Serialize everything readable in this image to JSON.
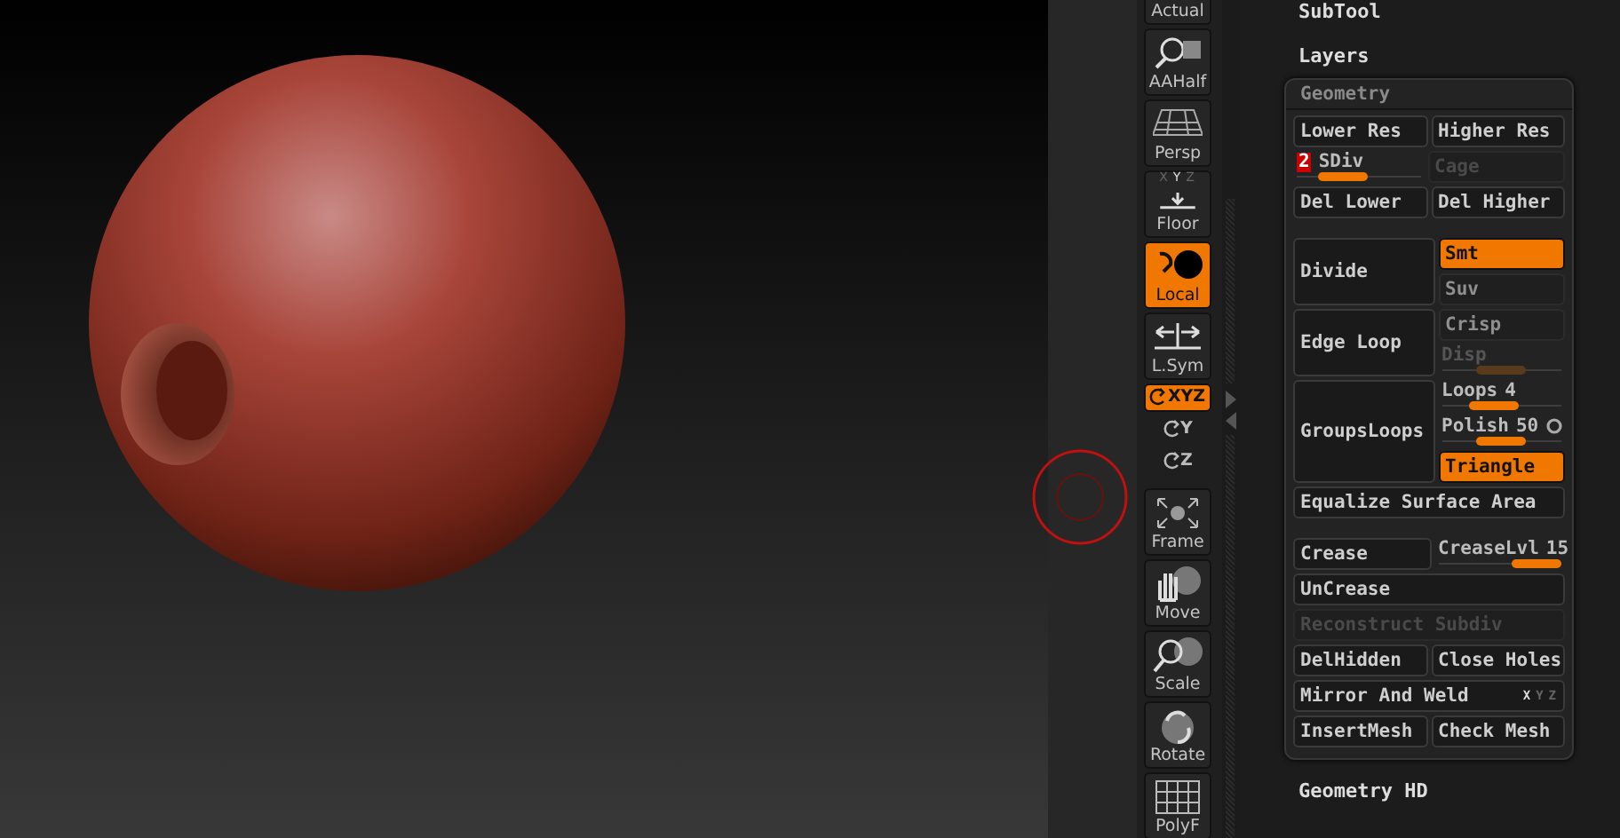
{
  "shelf": [
    {
      "kind": "big",
      "label": "Actual",
      "selected": false
    },
    {
      "kind": "big",
      "label": "AAHalf",
      "selected": false
    },
    {
      "kind": "big",
      "label": "Persp",
      "selected": false
    },
    {
      "kind": "big",
      "label": "Floor",
      "selected": false,
      "axes": [
        {
          "label": "X",
          "on": false
        },
        {
          "label": "Y",
          "on": true
        },
        {
          "label": "Z",
          "on": false
        }
      ]
    },
    {
      "kind": "big",
      "label": "Local",
      "selected": true
    },
    {
      "kind": "big",
      "label": "L.Sym",
      "selected": false
    },
    {
      "kind": "mini",
      "label": "XYZ",
      "selected": true
    },
    {
      "kind": "mini",
      "label": "Y",
      "selected": false
    },
    {
      "kind": "mini",
      "label": "Z",
      "selected": false
    },
    {
      "kind": "big",
      "label": "Frame",
      "selected": false
    },
    {
      "kind": "big",
      "label": "Move",
      "selected": false
    },
    {
      "kind": "big",
      "label": "Scale",
      "selected": false
    },
    {
      "kind": "big",
      "label": "Rotate",
      "selected": false
    },
    {
      "kind": "big",
      "label": "PolyF",
      "selected": false
    }
  ],
  "menu_top": [
    "SubTool",
    "Layers"
  ],
  "geometry": {
    "title": "Geometry",
    "groups": [
      [
        {
          "kind": "pair",
          "items": [
            {
              "kind": "button",
              "label": "Lower Res"
            },
            {
              "kind": "button",
              "label": "Higher Res"
            }
          ]
        },
        {
          "kind": "pair",
          "items": [
            {
              "kind": "slider",
              "badge": "2",
              "label": "SDiv",
              "level": 0.3
            },
            {
              "kind": "button",
              "label": "Cage",
              "disabled": true
            }
          ]
        },
        {
          "kind": "pair",
          "items": [
            {
              "kind": "button",
              "label": "Del Lower"
            },
            {
              "kind": "button",
              "label": "Del Higher"
            }
          ]
        }
      ],
      [
        {
          "kind": "tall",
          "main": "Divide",
          "side": [
            {
              "kind": "toggle",
              "label": "Smt",
              "selected": true
            },
            {
              "kind": "toggle",
              "label": "Suv",
              "selected": false
            }
          ]
        },
        {
          "kind": "tall",
          "main": "Edge Loop",
          "side": [
            {
              "kind": "toggle",
              "label": "Crisp",
              "selected": false
            },
            {
              "kind": "slider",
              "label": "Disp",
              "level": 0.5,
              "disabled": true
            }
          ]
        },
        {
          "kind": "tall",
          "main": "GroupsLoops",
          "side": [
            {
              "kind": "slider",
              "label": "Loops",
              "value": "4",
              "level": 0.4
            },
            {
              "kind": "slider",
              "label": "Polish",
              "value": "50",
              "level": 0.5,
              "dot": true
            },
            {
              "kind": "toggle",
              "label": "Triangle",
              "selected": true
            }
          ]
        },
        {
          "kind": "full",
          "item": {
            "kind": "button",
            "label": "Equalize Surface Area"
          }
        }
      ],
      [
        {
          "kind": "pair",
          "items": [
            {
              "kind": "button",
              "label": "Crease"
            },
            {
              "kind": "slider",
              "label": "CreaseLvl",
              "value": "15",
              "level": 1
            }
          ]
        },
        {
          "kind": "full",
          "item": {
            "kind": "button",
            "label": "UnCrease"
          }
        },
        {
          "kind": "full",
          "item": {
            "kind": "button",
            "label": "Reconstruct Subdiv",
            "disabled": true
          }
        },
        {
          "kind": "pair",
          "items": [
            {
              "kind": "button",
              "label": "DelHidden"
            },
            {
              "kind": "button",
              "label": "Close Holes"
            }
          ]
        },
        {
          "kind": "full",
          "item": {
            "kind": "button",
            "label": "Mirror And Weld",
            "axes": [
              {
                "label": "X",
                "on": true
              },
              {
                "label": "Y",
                "on": false
              },
              {
                "label": "Z",
                "on": false
              }
            ]
          }
        },
        {
          "kind": "pair",
          "items": [
            {
              "kind": "button",
              "label": "InsertMesh"
            },
            {
              "kind": "button",
              "label": "Check Mesh"
            }
          ]
        }
      ]
    ]
  },
  "menu_bottom": [
    "Geometry HD"
  ]
}
